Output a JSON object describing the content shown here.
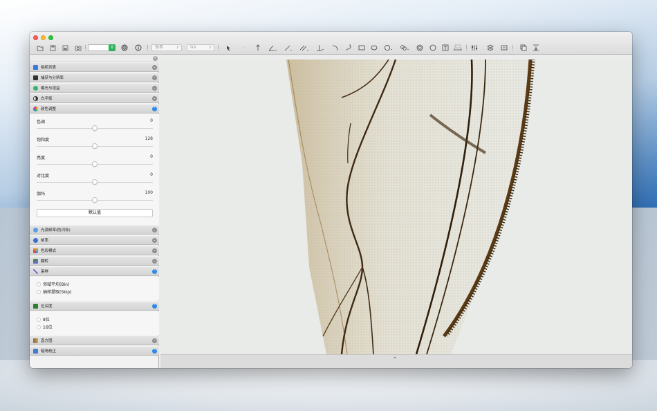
{
  "toolbar": {
    "unit_select": "像素",
    "value_select": "NA",
    "tools": [
      "open-folder-icon",
      "save-icon",
      "export-icon",
      "camera-icon",
      "target-icon",
      "info-icon",
      "pointer-icon",
      "arrow-icon",
      "angle-icon",
      "line-icon",
      "parallel-icon",
      "perpendicular-icon",
      "arc-icon",
      "curve-icon",
      "rectangle-icon",
      "ellipse-icon",
      "circle-options-icon",
      "multi-circle-icon",
      "concentric-icon",
      "circle-icon",
      "text-icon",
      "scale-bar-icon",
      "calibrate-icon",
      "layers-icon",
      "fit-icon",
      "copy-icon",
      "align-icon"
    ],
    "scale_label": "1mm"
  },
  "sidebar": {
    "sections_top": [
      {
        "label": "相机列表",
        "open": false,
        "color": "#3a7bd5"
      },
      {
        "label": "捕获与分辨率",
        "open": false,
        "color": "#333333"
      },
      {
        "label": "曝光与增益",
        "open": false,
        "color": "#3cb371"
      },
      {
        "label": "白平衡",
        "open": false,
        "color": "#555555"
      },
      {
        "label": "颜色调整",
        "open": true,
        "color": "#e0508c"
      }
    ],
    "color_adjust": {
      "sliders": [
        {
          "name": "色调",
          "value": "0",
          "pos": 0.5
        },
        {
          "name": "饱和度",
          "value": "128",
          "pos": 0.5
        },
        {
          "name": "亮度",
          "value": "0",
          "pos": 0.5
        },
        {
          "name": "对比度",
          "value": "0",
          "pos": 0.5
        },
        {
          "name": "伽玛",
          "value": "100",
          "pos": 0.5
        }
      ],
      "default_button": "默认值"
    },
    "sections_mid": [
      {
        "label": "光源频率(防闪烁)",
        "open": false,
        "color": "#5aa0e0"
      },
      {
        "label": "帧率",
        "open": false,
        "color": "#3a6fd0"
      },
      {
        "label": "色彩模式",
        "open": false,
        "color": "#e0a020"
      },
      {
        "label": "翻转",
        "open": false,
        "color": "#4a8a4a"
      },
      {
        "label": "采样",
        "open": true,
        "color": "#7a5ad0"
      }
    ],
    "sampling": {
      "options": [
        "邻域平均(Bin)",
        "抽样提取(Skip)"
      ]
    },
    "bit_depth_section": {
      "label": "位深度",
      "open": true,
      "color": "#2e7d32"
    },
    "bit_depth": {
      "options": [
        "8位",
        "16位"
      ]
    },
    "sections_bottom": [
      {
        "label": "直方图",
        "open": false,
        "color": "#8a6a3a"
      },
      {
        "label": "暗场校正",
        "open": true,
        "color": "#4a7ad0"
      }
    ]
  }
}
